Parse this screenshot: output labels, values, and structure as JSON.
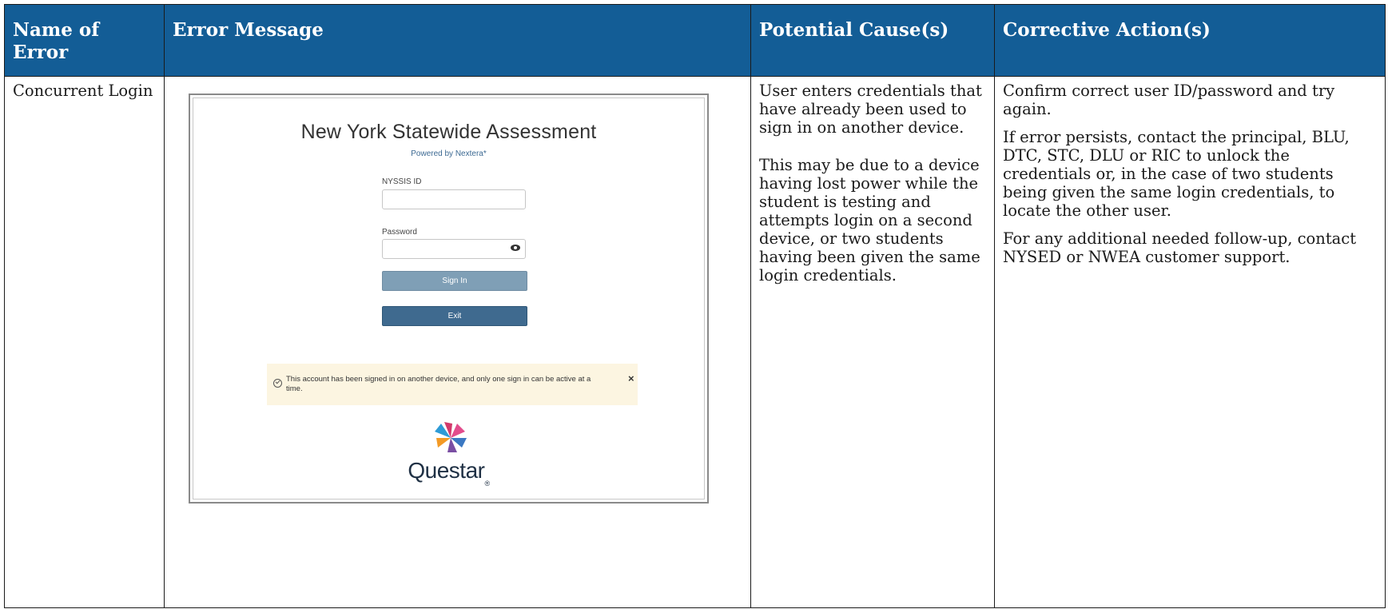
{
  "table": {
    "headers": [
      "Name of Error",
      "Error Message",
      "Potential Cause(s)",
      "Corrective Action(s)"
    ],
    "row": {
      "name": "Concurrent Login",
      "causes": [
        "User enters credentials that have already been used to sign in on another device.",
        "This may be due to a device having lost power while the student is testing and attempts login on a second device, or two students having been given the same login credentials."
      ],
      "actions": [
        "Confirm correct user ID/password and try again.",
        "If error persists, contact the principal, BLU, DTC, STC, DLU or RIC to unlock the credentials or, in the case of two students being given the same login credentials, to locate the other user.",
        "For any additional needed follow-up, contact NYSED or NWEA customer support."
      ]
    }
  },
  "screenshot": {
    "title": "New York Statewide Assessment",
    "powered_by": "Powered by Nextera*",
    "id_label": "NYSSIS ID",
    "id_value": "",
    "password_label": "Password",
    "password_value": "",
    "password_toggle_icon": "eye-icon",
    "sign_in_label": "Sign In",
    "exit_label": "Exit",
    "alert": {
      "message": "This account has been signed in on another device, and only one sign in can be active at a time.",
      "icon": "check-circle-icon",
      "close": "×"
    },
    "brand": "Questar",
    "brand_mark": "®",
    "colors": {
      "sign_in": "#7f9fb6",
      "exit": "#3f6a8f",
      "alert_bg": "#fcf5e1"
    }
  },
  "colors": {
    "header_bg": "#135d96",
    "header_text": "#ffffff"
  }
}
